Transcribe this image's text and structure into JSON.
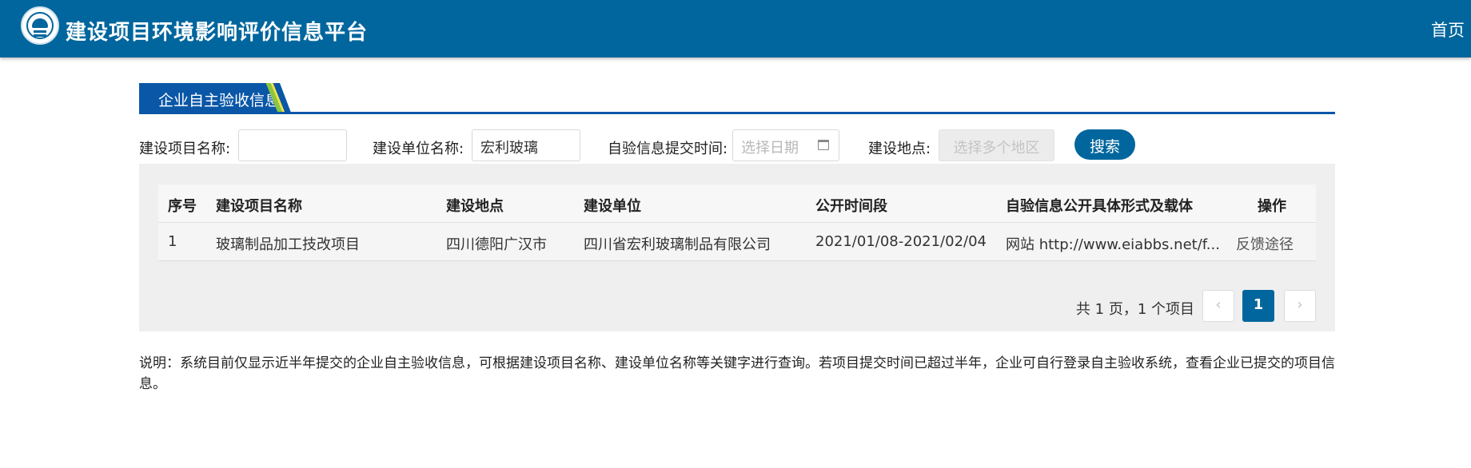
{
  "header": {
    "title": "建设项目环境影响评价信息平台",
    "home_link": "首页"
  },
  "tab": {
    "label": "企业自主验收信息"
  },
  "filters": {
    "project_name_label": "建设项目名称:",
    "project_name_value": "",
    "unit_name_label": "建设单位名称:",
    "unit_name_value": "宏利玻璃",
    "submit_time_label": "自验信息提交时间:",
    "submit_time_placeholder": "选择日期",
    "location_label": "建设地点:",
    "location_placeholder": "选择多个地区",
    "search_label": "搜索"
  },
  "table": {
    "columns": [
      "序号",
      "建设项目名称",
      "建设地点",
      "建设单位",
      "公开时间段",
      "自验信息公开具体形式及载体",
      "操作"
    ],
    "rows": [
      [
        "1",
        "玻璃制品加工技改项目",
        "四川德阳广汉市",
        "四川省宏利玻璃制品有限公司",
        "2021/01/08-2021/02/04",
        "网站 http://www.eiabbs.net/f...",
        "反馈途径"
      ]
    ]
  },
  "pagination": {
    "summary": "共 1 页，1 个项目",
    "prev": "‹",
    "current": "1",
    "next": "›"
  },
  "note": "说明：系统目前仅显示近半年提交的企业自主验收信息，可根据建设项目名称、建设单位名称等关键字进行查询。若项目提交时间已超过半年，企业可自行登录自主验收系统，查看企业已提交的项目信息。",
  "colors": {
    "header_bg": "#00669d",
    "tab_bg": "#0a57a7",
    "stripe_green": "#8cc63f",
    "stripe_yellow": "#f2e14c",
    "panel_bg": "#efefef"
  },
  "icons": {
    "logo": "ministry-emblem-icon",
    "calendar": "calendar-icon"
  }
}
